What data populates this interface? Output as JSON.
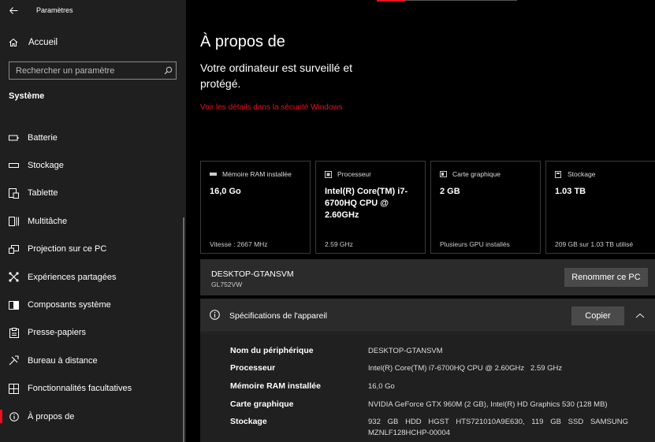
{
  "app": {
    "title": "Paramètres"
  },
  "sidebar": {
    "home_label": "Accueil",
    "search_placeholder": "Rechercher un paramètre",
    "section_title": "Système",
    "items": [
      {
        "label": "Batterie",
        "icon": "battery-icon"
      },
      {
        "label": "Stockage",
        "icon": "storage-icon"
      },
      {
        "label": "Tablette",
        "icon": "tablet-icon"
      },
      {
        "label": "Multitâche",
        "icon": "multitask-icon"
      },
      {
        "label": "Projection sur ce PC",
        "icon": "projection-icon"
      },
      {
        "label": "Expériences partagées",
        "icon": "shared-icon"
      },
      {
        "label": "Composants système",
        "icon": "components-icon"
      },
      {
        "label": "Presse-papiers",
        "icon": "clipboard-icon"
      },
      {
        "label": "Bureau à distance",
        "icon": "remote-desktop-icon"
      },
      {
        "label": "Fonctionnalités facultatives",
        "icon": "optional-features-icon"
      },
      {
        "label": "À propos de",
        "icon": "info-icon",
        "active": true
      }
    ]
  },
  "main": {
    "title": "À propos de",
    "protection_text": "Votre ordinateur est surveillé et protégé.",
    "security_link": "Voir les détails dans la sécurité Windows",
    "cards": [
      {
        "header": "Mémoire RAM installée",
        "value": "16,0 Go",
        "sub": "Vitesse : 2667 MHz",
        "icon": "ram-icon"
      },
      {
        "header": "Processeur",
        "value": "Intel(R) Core(TM) i7-6700HQ CPU @ 2.60GHz",
        "sub": "2.59 GHz",
        "icon": "cpu-icon"
      },
      {
        "header": "Carte graphique",
        "value": "2 GB",
        "sub": "Plusieurs GPU installés",
        "icon": "gpu-icon"
      },
      {
        "header": "Stockage",
        "value": "1.03 TB",
        "sub": "209 GB sur 1.03 TB utilisé",
        "icon": "disk-icon"
      }
    ],
    "device": {
      "name": "DESKTOP-GTANSVM",
      "model": "GL752VW",
      "rename_label": "Renommer ce PC"
    },
    "specs": {
      "title": "Spécifications de l'appareil",
      "copy_label": "Copier",
      "rows": [
        {
          "key": "Nom du périphérique",
          "value": "DESKTOP-GTANSVM"
        },
        {
          "key": "Processeur",
          "value": "Intel(R) Core(TM) i7-6700HQ CPU @ 2.60GHz   2.59 GHz"
        },
        {
          "key": "Mémoire RAM installée",
          "value": "16,0 Go"
        },
        {
          "key": "Carte graphique",
          "value": "NVIDIA GeForce GTX 960M (2 GB), Intel(R) HD Graphics 530 (128 MB)"
        },
        {
          "key": "Stockage",
          "value": "932 GB HDD HGST HTS721010A9E630, 119 GB SSD SAMSUNG MZNLF128HCHP-00004"
        }
      ]
    }
  },
  "colors": {
    "accent": "#e81123",
    "sidebar_bg": "#1f1f1f",
    "panel_bg": "#2b2b2b"
  }
}
